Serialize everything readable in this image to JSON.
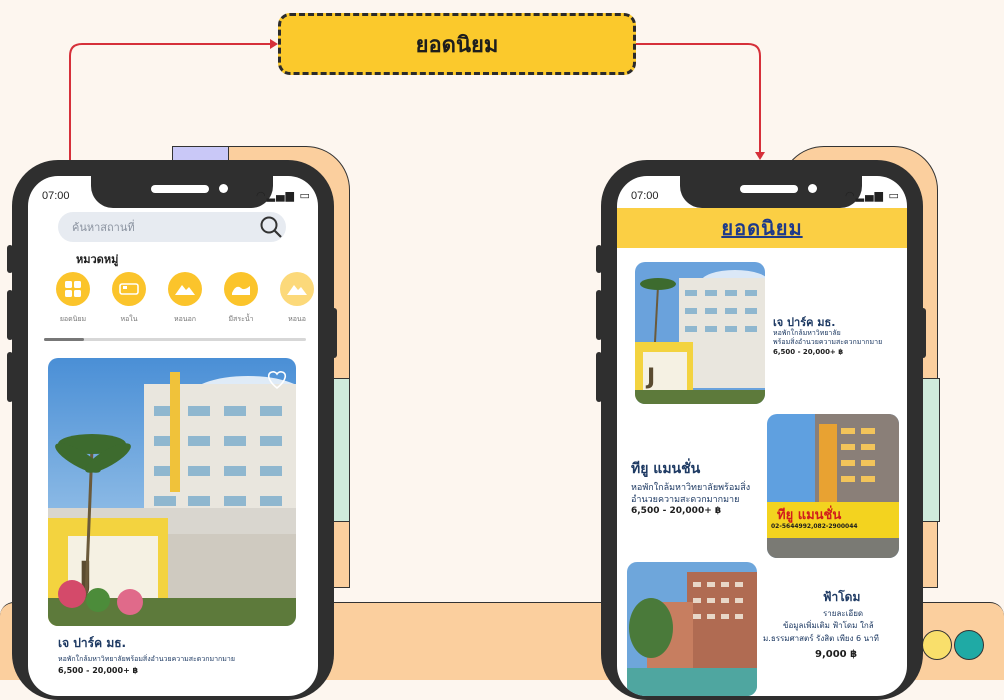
{
  "flow_label": "ยอดนิยม",
  "phone_left": {
    "time": "07:00",
    "search_placeholder": "ค้นหาสถานที่",
    "category_heading": "หมวดหมู่",
    "categories": [
      {
        "label": "ยอดนิยม",
        "icon": "grid-icon"
      },
      {
        "label": "หอใน",
        "icon": "bed-icon"
      },
      {
        "label": "หอนอก",
        "icon": "mountain-icon"
      },
      {
        "label": "มีสระน้ำ",
        "icon": "wave-icon"
      },
      {
        "label": "หอนอ",
        "icon": "mountain-icon"
      }
    ],
    "card": {
      "name": "เจ ปาร์ค มธ.",
      "desc": "หอพักใกล้มหาวิทยาลัยพร้อมสิ่งอำนวยความสะดวกมากมาย",
      "price": "6,500 - 20,000+ ฿"
    }
  },
  "phone_right": {
    "time": "07:00",
    "header_title": "ยอดนิยม",
    "items": [
      {
        "name": "เจ ปาร์ค มธ.",
        "desc1": "หอพักใกล้มหาวิทยาลัย",
        "desc2": "พร้อมสิ่งอำนวยความสะดวกมากมาย",
        "price": "6,500 - 20,000+ ฿"
      },
      {
        "name": "ทียู แมนชั่น",
        "desc1": "หอพักใกล้มหาวิทยาลัยพร้อมสิ่ง",
        "desc2": "อำนวยความสะดวกมากมาย",
        "price": "6,500 - 20,000+ ฿",
        "sign": "ทียู แมนชั่น",
        "sign_phone": "02-5644992,082-2900044"
      },
      {
        "name": "ฟ้าโดม",
        "desc1": "รายละเอียด",
        "desc2": "ข้อมูลเพิ่มเติม ฟ้าโดม ใกล้",
        "desc3": "ม.ธรรมศาสตร์ รังสิต เพียง 6 นาที",
        "price": "9,000 ฿"
      }
    ]
  },
  "colors": {
    "accent": "#fbc42b",
    "navy": "#1e3a63",
    "arrow": "#d6303a"
  }
}
